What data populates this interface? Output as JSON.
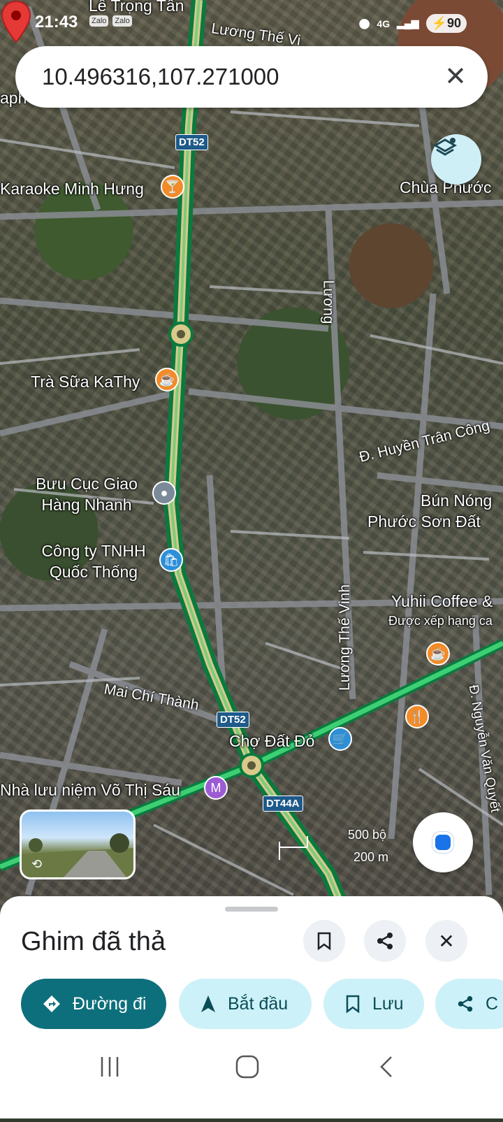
{
  "status_bar": {
    "time": "21:43",
    "app_icons": [
      "Zalo",
      "Zalo"
    ],
    "network": "4G",
    "battery": "90"
  },
  "search": {
    "query": "10.496316,107.271000",
    "clear_icon": "close-icon"
  },
  "map": {
    "labels": {
      "le_trong_tan": "Lê Trọng Tấn",
      "luong_the_vinh_top": "Lương Thế Vi",
      "aph": "aph",
      "karaoke": "Karaoke Minh Hưng",
      "chua": "Chùa Phước",
      "tra_sua": "Trà Sữa KaThy",
      "buu_cuc_1": "Bưu Cục Giao",
      "buu_cuc_2": "Hàng Nhanh",
      "cong_ty_1": "Công ty TNHH",
      "cong_ty_2": "Quốc Thống",
      "huyen_tran": "Đ. Huyền Trân Công",
      "bun_1": "Bún Nóng",
      "bun_2": "Phước Sơn Đất",
      "yuhii": "Yuhii Coffee &",
      "yuhii_sub": "Được xếp hạng ca",
      "luong_the_vinh": "Lương Thế Vinh",
      "luong_vertical": "Lương",
      "mai_chi_thanh": "Mai Chí Thành",
      "cho_dat_do": "Chợ Đất Đỏ",
      "nha_luu_niem": "Nhà lưu niệm Võ Thị Sáu",
      "nguyen_van_quyet": "Đ. Nguyễn Văn Quyết"
    },
    "shields": {
      "dt52_top": "DT52",
      "dt52_bottom": "DT52",
      "dt44a": "DT44A"
    },
    "scale": {
      "imperial": "500 bộ",
      "metric": "200 m"
    },
    "pin_icon": "map-pin-icon",
    "layers_icon": "layers-icon"
  },
  "sheet": {
    "title": "Ghim đã thả",
    "actions": {
      "directions": "Đường đi",
      "start": "Bắt đầu",
      "save": "Lưu",
      "share_partial": "C"
    }
  },
  "colors": {
    "primary_chip": "#0e6f7c",
    "secondary_chip": "#cdf1f8",
    "pin": "#e53935",
    "route": "#2ecc71"
  }
}
